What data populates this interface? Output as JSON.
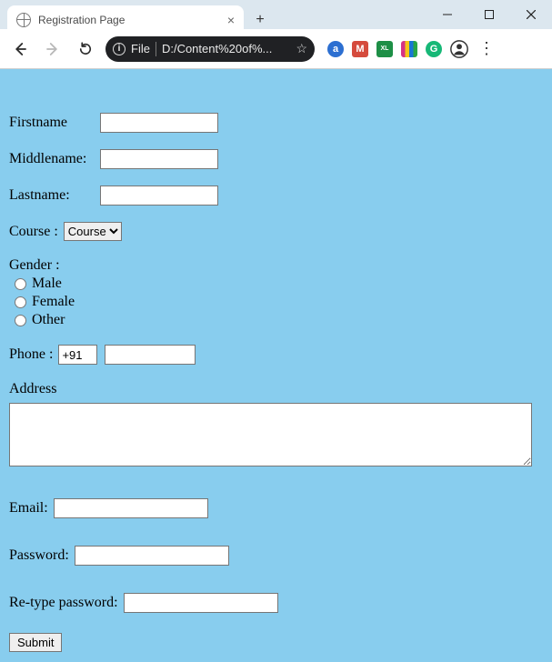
{
  "browser": {
    "tab_title": "Registration Page",
    "url_scheme_label": "File",
    "url_text": "D:/Content%20of%...",
    "a_icon_label": "a",
    "m_icon_label": "M",
    "excel_icon_label": "XL",
    "g_icon_label": "G"
  },
  "form": {
    "firstname_label": "Firstname",
    "middlename_label": "Middlename:",
    "lastname_label": "Lastname:",
    "course_label": "Course :",
    "course_option": "Course",
    "gender_label": "Gender :",
    "gender_options": {
      "male": "Male",
      "female": "Female",
      "other": "Other"
    },
    "phone_label": "Phone :",
    "phone_prefix_value": "+91",
    "address_label": "Address",
    "email_label": "Email:",
    "password_label": "Password:",
    "retype_label": "Re-type password:",
    "submit_label": "Submit"
  }
}
